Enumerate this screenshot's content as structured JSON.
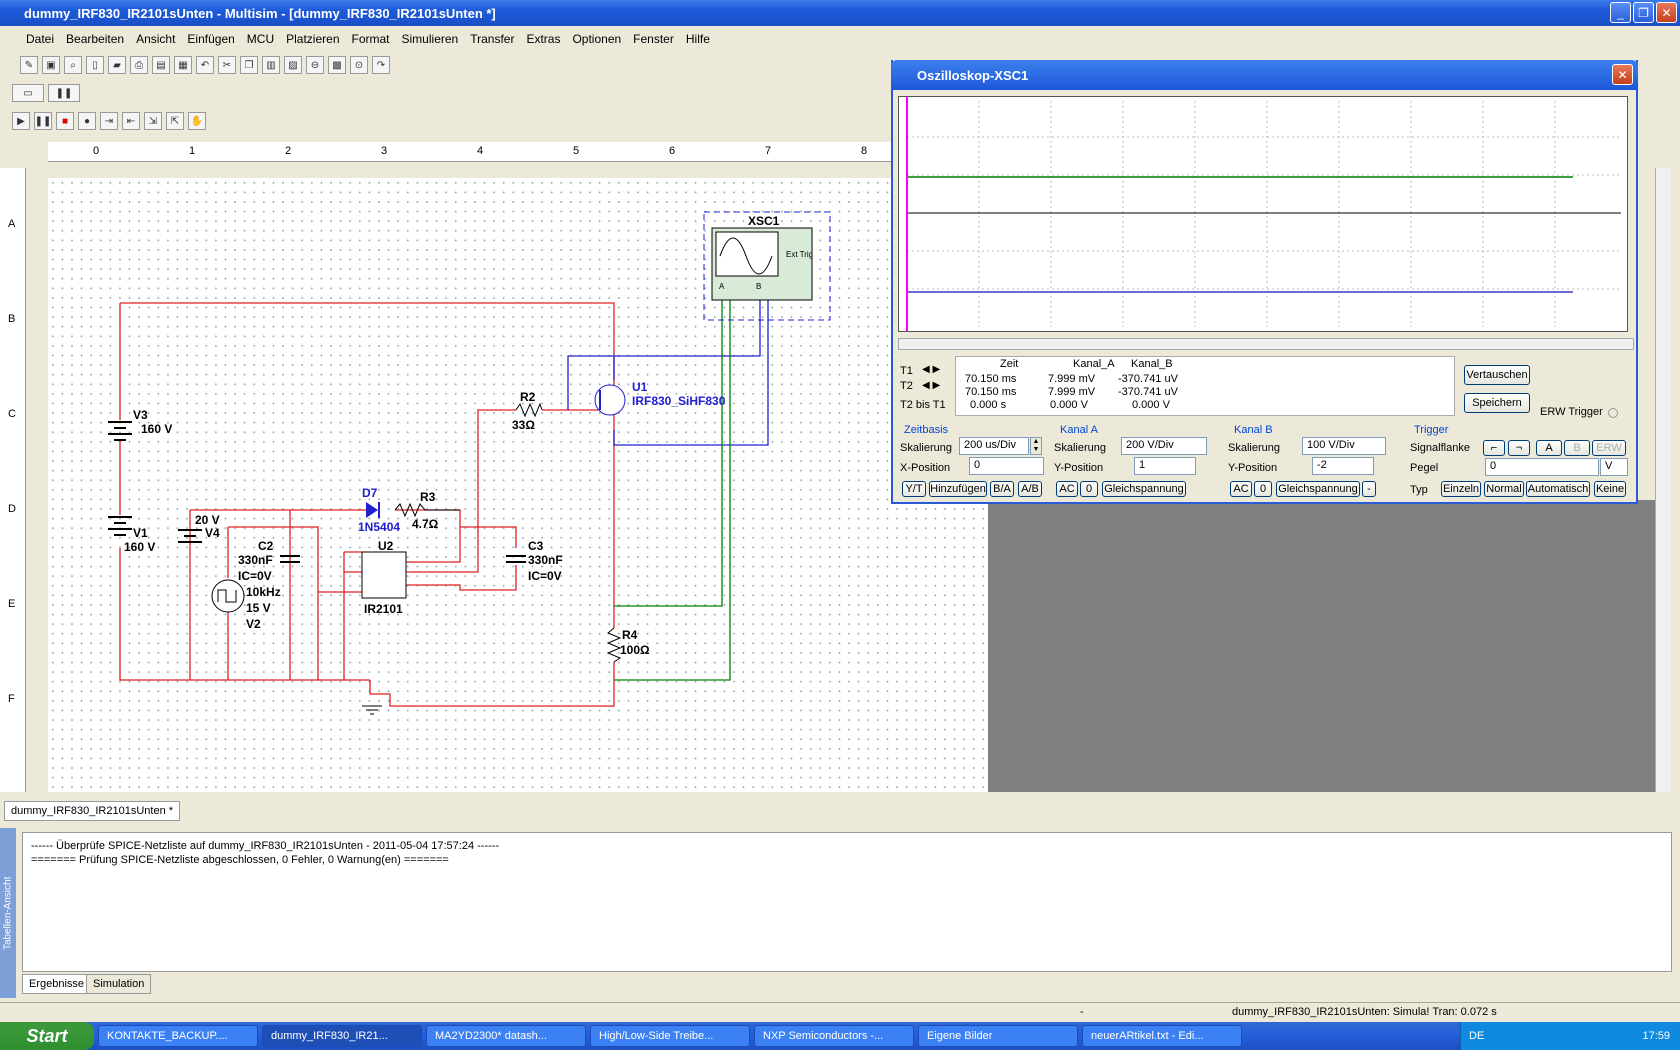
{
  "window": {
    "title": "dummy_IRF830_IR2101sUnten - Multisim - [dummy_IRF830_IR2101sUnten *]",
    "minimize": "_",
    "restore": "❐",
    "close": "✕"
  },
  "menu": [
    "Datei",
    "Bearbeiten",
    "Ansicht",
    "Einfügen",
    "MCU",
    "Platzieren",
    "Format",
    "Simulieren",
    "Transfer",
    "Extras",
    "Optionen",
    "Fenster",
    "Hilfe"
  ],
  "ruler": {
    "columns": [
      "0",
      "1",
      "2",
      "3",
      "4",
      "5",
      "6",
      "7",
      "8"
    ],
    "rows": [
      "A",
      "B",
      "C",
      "D",
      "E",
      "F"
    ]
  },
  "schematic": {
    "instrument": "XSC1",
    "ext_trig": "Ext Trig",
    "port_a": "A",
    "port_b": "B",
    "components": {
      "V3": "V3",
      "V3_val": "160 V",
      "V1": "V1",
      "V1_val": "160 V",
      "V4_v": "20 V",
      "V4": "V4",
      "C2": "C2",
      "C2_val": "330nF",
      "C2_ic": "IC=0V",
      "V2_f": "10kHz",
      "V2_v": "15 V",
      "V2": "V2",
      "D7": "D7",
      "D7_val": "1N5404",
      "R3": "R3",
      "R3_val": "4.7Ω",
      "R2": "R2",
      "R2_val": "33Ω",
      "U1": "U1",
      "U1_val": "IRF830_SiHF830",
      "U2": "U2",
      "U2_val": "IR2101",
      "C3": "C3",
      "C3_val": "330nF",
      "C3_ic": "IC=0V",
      "R4": "R4",
      "R4_val": "100Ω"
    }
  },
  "scope": {
    "title": "Oszilloskop-XSC1",
    "table": {
      "headers": [
        "",
        "Zeit",
        "Kanal_A",
        "Kanal_B"
      ],
      "rows": [
        [
          "T1",
          "70.150 ms",
          "7.999 mV",
          "-370.741 uV"
        ],
        [
          "T2",
          "70.150 ms",
          "7.999 mV",
          "-370.741 uV"
        ],
        [
          "T2 bis T1",
          "0.000 s",
          "0.000 V",
          "0.000 V"
        ]
      ]
    },
    "buttons": {
      "swap": "Vertauschen",
      "save": "Speichern"
    },
    "erw_trigger": "ERW Trigger",
    "timebase": {
      "title": "Zeitbasis",
      "scale_label": "Skalierung",
      "scale": "200 us/Div",
      "xpos_label": "X-Position",
      "xpos": "0",
      "modes": [
        "Y/T",
        "Hinzufügen",
        "B/A",
        "A/B"
      ]
    },
    "channel_a": {
      "title": "Kanal A",
      "scale_label": "Skalierung",
      "scale": "200  V/Div",
      "ypos_label": "Y-Position",
      "ypos": "1",
      "coupling": [
        "AC",
        "0",
        "Gleichspannung"
      ]
    },
    "channel_b": {
      "title": "Kanal B",
      "scale_label": "Skalierung",
      "scale": "100  V/Div",
      "ypos_label": "Y-Position",
      "ypos": "-2",
      "coupling": [
        "AC",
        "0",
        "Gleichspannung",
        "-"
      ]
    },
    "trigger": {
      "title": "Trigger",
      "edge_label": "Signalflanke",
      "sources": [
        "A",
        "B",
        "ERW"
      ],
      "level_label": "Pegel",
      "level": "0",
      "level_unit": "V",
      "type_label": "Typ",
      "types": [
        "Einzeln",
        "Normal",
        "Automatisch",
        "Keine"
      ]
    },
    "colors": {
      "channel_a": "#008000",
      "channel_b": "#3a3ad0",
      "cursor": "#ff00ff"
    }
  },
  "doc_tab": "dummy_IRF830_IR2101sUnten *",
  "log": {
    "lines": [
      "------ Überprüfe SPICE-Netzliste auf dummy_IRF830_IR2101sUnten - 2011-05-04 17:57:24 ------",
      "======= Prüfung SPICE-Netzliste abgeschlossen, 0 Fehler, 0 Warnung(en) ======="
    ],
    "side_label": "Tabellen-Ansicht",
    "tabs": [
      "Ergebnisse",
      "Simulation"
    ]
  },
  "status": {
    "dash": "-",
    "text": "dummy_IRF830_IR2101sUnten: Simula! Tran: 0.072 s"
  },
  "taskbar": {
    "start": "Start",
    "items": [
      "KONTAKTE_BACKUP....",
      "dummy_IRF830_IR21...",
      "MA2YD2300* datash...",
      "High/Low-Side Treibe...",
      "NXP Semiconductors -...",
      "Eigene Bilder",
      "neuerARtikel.txt - Edi..."
    ],
    "lang": "DE",
    "clock": "17:59"
  }
}
